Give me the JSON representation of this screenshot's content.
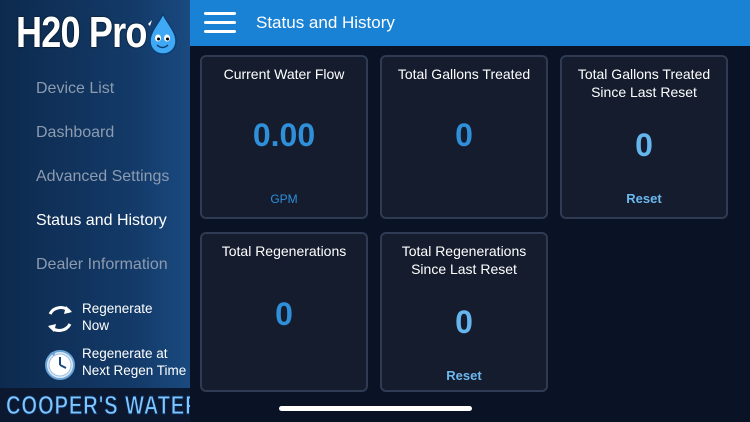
{
  "brand": {
    "name": "H20 Pro",
    "logo_icon": "water-drop-mascot-icon"
  },
  "header": {
    "title": "Status and History",
    "menu_icon": "hamburger-menu-icon"
  },
  "sidebar": {
    "items": [
      {
        "label": "Device List",
        "active": false
      },
      {
        "label": "Dashboard",
        "active": false
      },
      {
        "label": "Advanced Settings",
        "active": false
      },
      {
        "label": "Status and History",
        "active": true
      },
      {
        "label": "Dealer Information",
        "active": false
      }
    ],
    "actions": [
      {
        "label": "Regenerate\nNow",
        "icon": "refresh-icon"
      },
      {
        "label": "Regenerate at\nNext Regen Time",
        "icon": "clock-icon"
      }
    ],
    "footer_logo": "COOPER'S WATER"
  },
  "cards": {
    "current_flow": {
      "title": "Current Water Flow",
      "value": "0.00",
      "unit": "GPM"
    },
    "total_gallons": {
      "title": "Total Gallons Treated",
      "value": "0"
    },
    "gallons_since_reset": {
      "title": "Total Gallons Treated\nSince Last Reset",
      "value": "0",
      "action": "Reset"
    },
    "total_regens": {
      "title": "Total Regenerations",
      "value": "0"
    },
    "regens_since_reset": {
      "title": "Total Regenerations\nSince Last Reset",
      "value": "0",
      "action": "Reset"
    }
  },
  "colors": {
    "header": "#1a82d4",
    "accent_value": "#2f8fd8",
    "card_bg": "#141c2e",
    "card_border": "#2f3b52",
    "background": "#0a1226"
  }
}
